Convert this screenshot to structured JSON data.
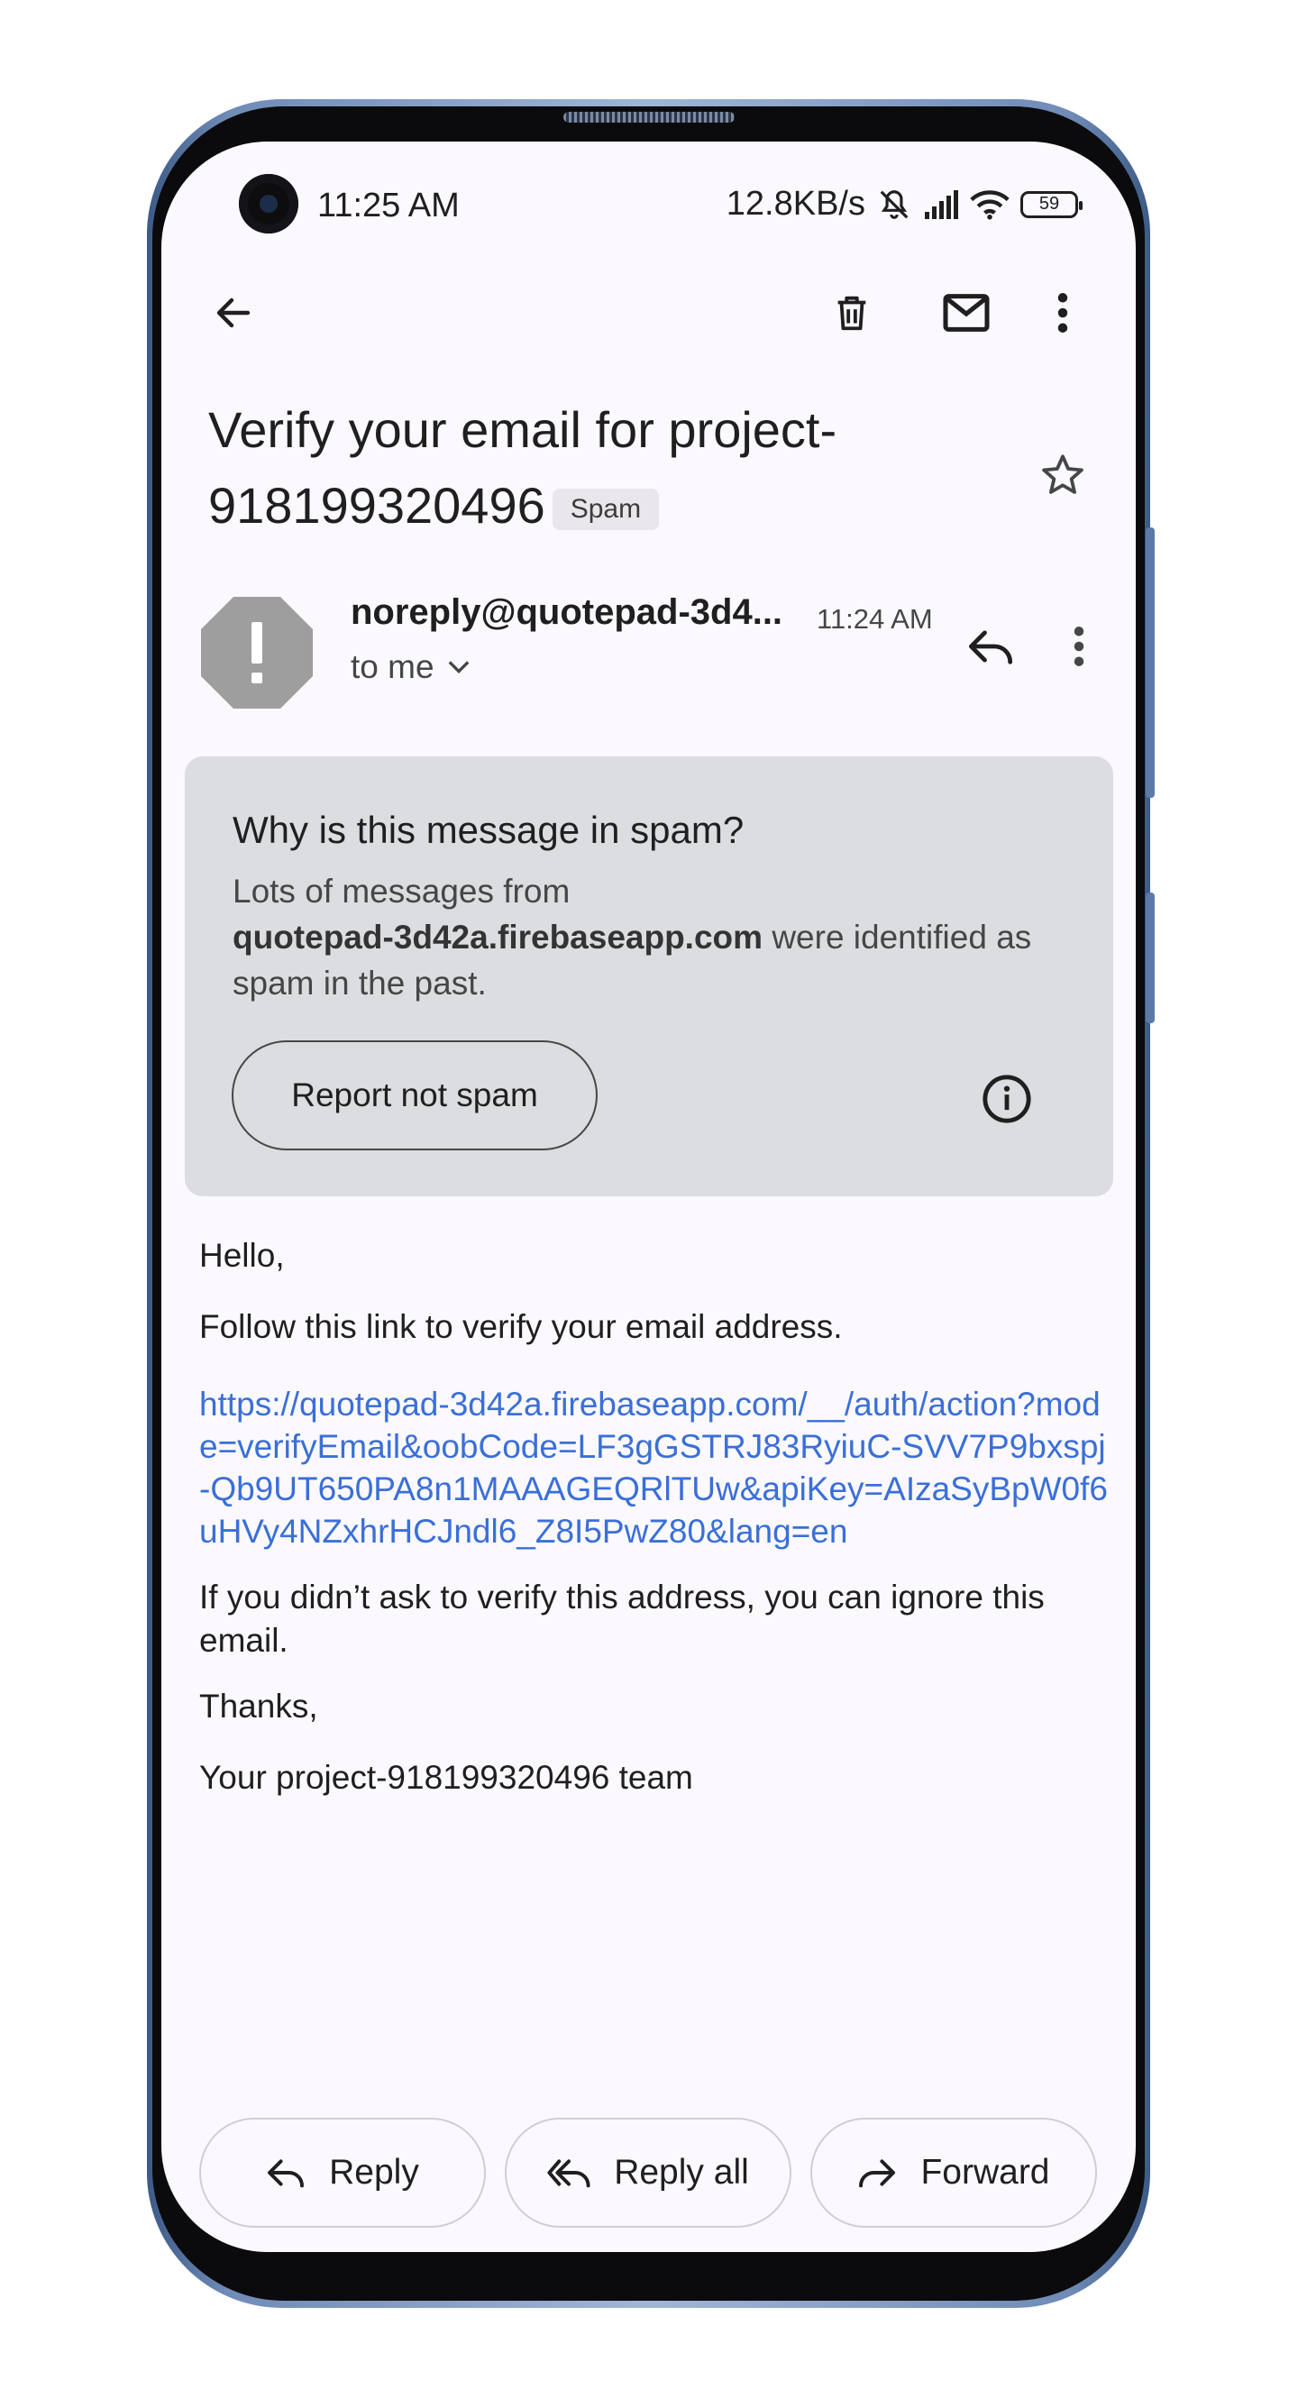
{
  "status_bar": {
    "time": "11:25 AM",
    "network_speed": "12.8KB/s",
    "battery": "59"
  },
  "toolbar": {
    "icons": [
      "back-arrow-icon",
      "delete-icon",
      "mark-unread-icon",
      "more-vertical-icon"
    ]
  },
  "email": {
    "subject": "Verify your email for project-918199320496",
    "label": "Spam",
    "sender": "noreply@quotepad-3d4...",
    "time": "11:24 AM",
    "recipient": "to me"
  },
  "spam_notice": {
    "title": "Why is this message in spam?",
    "body_prefix": "Lots of messages from",
    "domain": "quotepad-3d42a.firebaseapp.com",
    "body_suffix": "were identified as spam in the past.",
    "button_label": "Report not spam"
  },
  "body": {
    "greeting": "Hello,",
    "instruction": "Follow this link to verify your email address.",
    "link": "https://quotepad-3d42a.firebaseapp.com/__/auth/action?mode=verifyEmail&oobCode=LF3gGSTRJ83RyiuC-SVV7P9bxspj-Qb9UT650PA8n1MAAAGEQRlTUw&apiKey=AIzaSyBpW0f6uHVy4NZxhrHCJndl6_Z8I5PwZ80&lang=en",
    "ignore_note": "If you didn’t ask to verify this address, you can ignore this email.",
    "closing": "Thanks,",
    "signature": "Your project-918199320496 team"
  },
  "actions": {
    "reply": "Reply",
    "reply_all": "Reply all",
    "forward": "Forward"
  }
}
